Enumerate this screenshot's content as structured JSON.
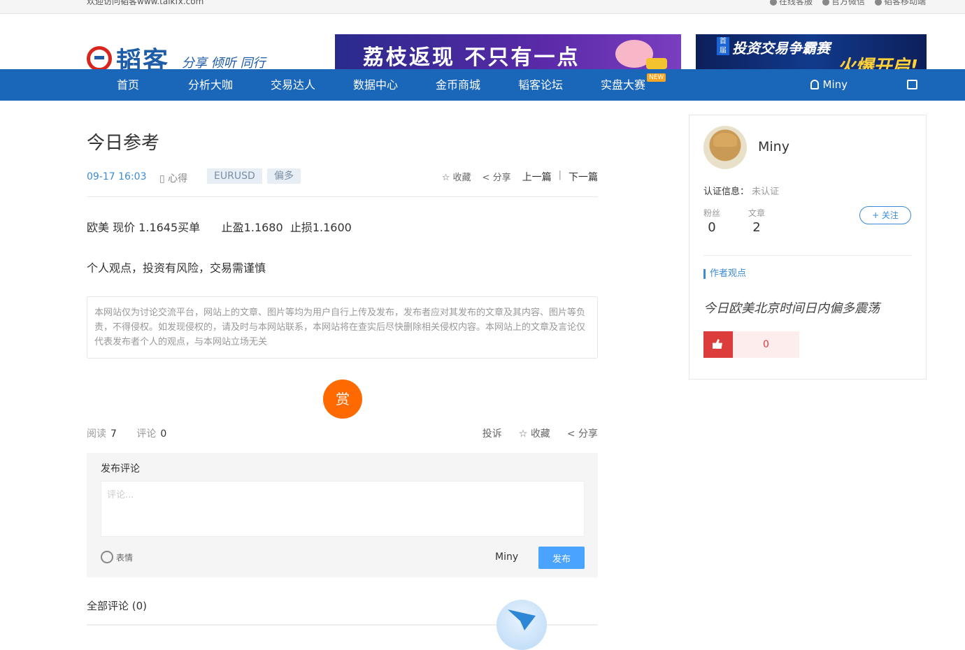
{
  "topbar": {
    "welcome": "欢迎访问韬客www.talkfx.com",
    "links": [
      "在线客服",
      "官方微信",
      "韬客移动端"
    ]
  },
  "header": {
    "logo_text": "韬客",
    "slogan": "分享 倾听 同行",
    "banner1_text": "荔枝返现 不只有一点",
    "banner2_tag": "首届",
    "banner2_line1": "投资交易争霸赛",
    "banner2_line2": "火爆开启!"
  },
  "nav": {
    "items": [
      "首页",
      "分析大咖",
      "交易达人",
      "数据中心",
      "金币商城",
      "韬客论坛",
      "实盘大赛"
    ],
    "new_badge": "NEW",
    "user": "Miny"
  },
  "article": {
    "title": "今日参考",
    "date": "09-17 16:03",
    "category": "心得",
    "tags": [
      "EURUSD",
      "偏多"
    ],
    "collect": "收藏",
    "share": "分享",
    "prev": "上一篇",
    "next": "下一篇",
    "para1": "欧美 现价 1.1645买单      止盈1.1680  止损1.1600",
    "para2": "个人观点，投资有风险，交易需谨慎",
    "disclaimer": "本网站仅为讨论交流平台，网站上的文章、图片等均为用户自行上传及发布，发布者应对其发布的文章及其内容、图片等负责，不得侵权。如发现侵权的，请及时与本网站联系，本网站将在查实后尽快删除相关侵权内容。本网站上的文章及言论仅代表发布者个人的观点，与本网站立场无关",
    "reward": "赏"
  },
  "stats": {
    "read_label": "阅读",
    "read_count": "7",
    "comment_label": "评论",
    "comment_count": "0",
    "report": "投诉",
    "collect": "收藏",
    "share": "分享"
  },
  "comment": {
    "label": "发布评论",
    "placeholder": "评论...",
    "emoji": "表情",
    "username": "Miny",
    "publish": "发布",
    "all_comments": "全部评论 (0)"
  },
  "sidebar": {
    "name": "Miny",
    "cert_label": "认证信息：",
    "cert_value": "未认证",
    "fans_label": "粉丝",
    "fans_count": "0",
    "articles_label": "文章",
    "articles_count": "2",
    "follow": "+ 关注",
    "section_title": "作者观点",
    "view_text": "今日欧美北京时间日内偏多震荡",
    "like_count": "0"
  },
  "colors": {
    "nav_blue": "#1a66b8",
    "link_blue": "#3b8bd6",
    "reward_orange": "#ff6a00",
    "like_red": "#dc3c3c",
    "publish_blue": "#4aa3ff"
  }
}
